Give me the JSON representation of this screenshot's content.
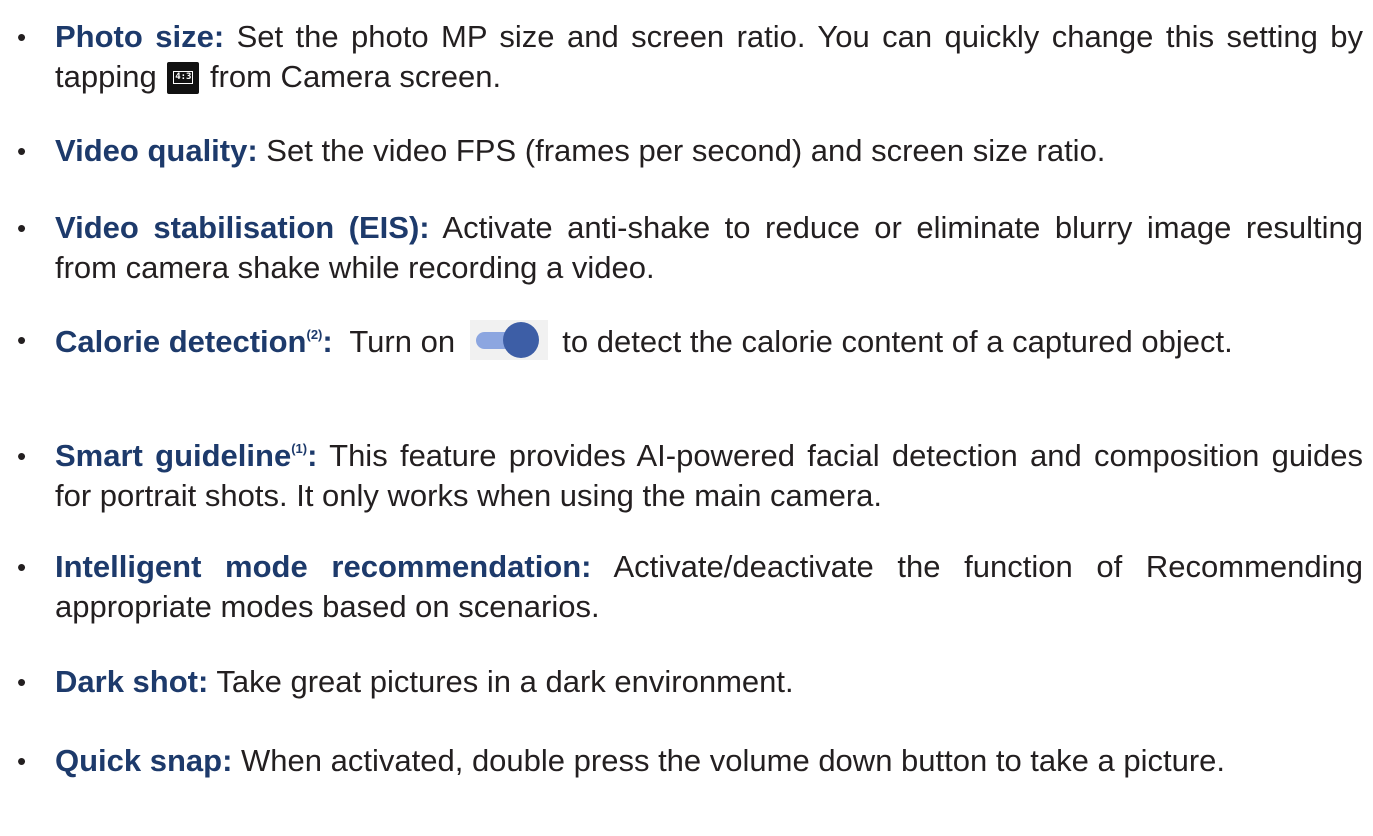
{
  "items": [
    {
      "term": "Photo size:",
      "text1": " Set the photo MP size and screen ratio. You can quickly change this setting by tapping ",
      "icon_label": "4:3",
      "text2": " from Camera screen."
    },
    {
      "term": "Video quality:",
      "text": " Set the video FPS (frames per second) and screen size ratio."
    },
    {
      "term": "Video stabilisation (EIS):",
      "text": " Activate anti-shake to reduce or eliminate blurry image resulting from camera shake while recording a video."
    },
    {
      "term": "Calorie detection",
      "sup": "(2)",
      "colon": ":",
      "text1": "  Turn on ",
      "text2": " to detect the calorie content of a captured object."
    },
    {
      "term": "Smart guideline",
      "sup": "(1)",
      "colon": ":",
      "text": " This feature provides AI-powered facial detection and composition guides for portrait shots. It only works when using the main camera."
    },
    {
      "term": "Intelligent mode recommendation:",
      "text": " Activate/deactivate the function of Recommending appropriate modes based on scenarios."
    },
    {
      "term": "Dark shot:",
      "text": " Take great pictures in a dark environment."
    },
    {
      "term": "Quick snap:",
      "text": " When activated, double press the volume down button to take a picture."
    }
  ],
  "bullet": "•",
  "icons": {
    "ratio": "aspect-ratio-icon",
    "toggle": "toggle-switch-icon"
  },
  "colors": {
    "term": "#1d3a6b",
    "text": "#231f20",
    "toggle_track": "#8ca6e0",
    "toggle_knob": "#3d5ea6"
  }
}
